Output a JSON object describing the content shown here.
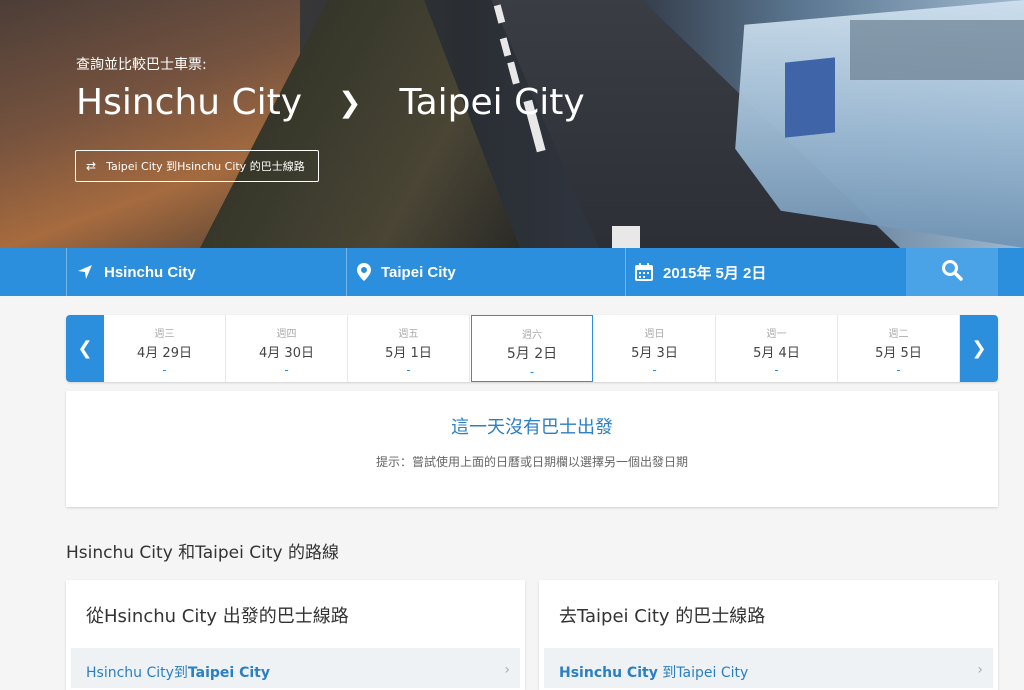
{
  "hero": {
    "subtitle": "查詢並比較巴士車票:",
    "from": "Hsinchu City",
    "to": "Taipei City",
    "reverse_label": "Taipei City 到Hsinchu City 的巴士線路"
  },
  "search": {
    "from": "Hsinchu City",
    "to": "Taipei City",
    "date": "2015年 5月 2日"
  },
  "dates": [
    {
      "weekday": "週三",
      "date": "4月 29日",
      "price": "-"
    },
    {
      "weekday": "週四",
      "date": "4月 30日",
      "price": "-"
    },
    {
      "weekday": "週五",
      "date": "5月 1日",
      "price": "-"
    },
    {
      "weekday": "週六",
      "date": "5月 2日",
      "price": "-"
    },
    {
      "weekday": "週日",
      "date": "5月 3日",
      "price": "-"
    },
    {
      "weekday": "週一",
      "date": "5月 4日",
      "price": "-"
    },
    {
      "weekday": "週二",
      "date": "5月 5日",
      "price": "-"
    }
  ],
  "nobus": {
    "title": "這一天沒有巴士出發",
    "hint": "提示：嘗試使用上面的日曆或日期欄以選擇另一個出發日期"
  },
  "routes": {
    "title": "Hsinchu City 和Taipei City 的路線",
    "from_card_title": "從Hsinchu City 出發的巴士線路",
    "from_row_a": "Hsinchu City到",
    "from_row_b": "Taipei City",
    "to_card_title": "去Taipei City 的巴士線路",
    "to_row_a": "Hsinchu City",
    "to_row_b": " 到Taipei City"
  },
  "colors": {
    "accent": "#2b8fdd",
    "link": "#2b7fc4"
  }
}
